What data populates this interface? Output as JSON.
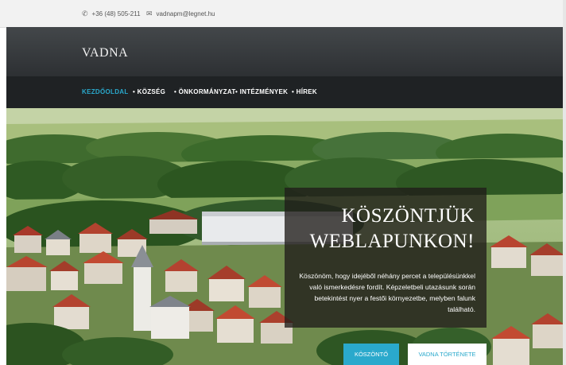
{
  "contact": {
    "phone": "+36 (48) 505-211",
    "email": "vadnapm@legnet.hu",
    "phone_icon": "phone-icon",
    "email_icon": "envelope-icon"
  },
  "brand": {
    "name": "VADNA"
  },
  "nav": {
    "items": [
      {
        "label": "KEZDŐOLDAL",
        "active": true
      },
      {
        "label": "• KÖZSÉG",
        "active": false
      },
      {
        "label": "• ÖNKORMÁNYZAT",
        "active": false
      },
      {
        "label": "• INTÉZMÉNYEK",
        "active": false
      },
      {
        "label": "• HÍREK",
        "active": false
      }
    ]
  },
  "hero": {
    "heading_line1": "KÖSZÖNTJÜK",
    "heading_line2": "WEBLAPUNKON!",
    "intro": "Köszönöm, hogy idejéből néhány percet a településünkkel való ismerkedésre fordít. Képzeletbeli utazásunk során betekintést nyer a festői környezetbe, melyben falunk található.",
    "primary_button": "KÖSZÖNTŐ",
    "secondary_button": "VADNA TÖRTÉNETE"
  },
  "colors": {
    "accent": "#2aa9cc",
    "header": "#3a3d40",
    "nav": "#1f2224"
  }
}
